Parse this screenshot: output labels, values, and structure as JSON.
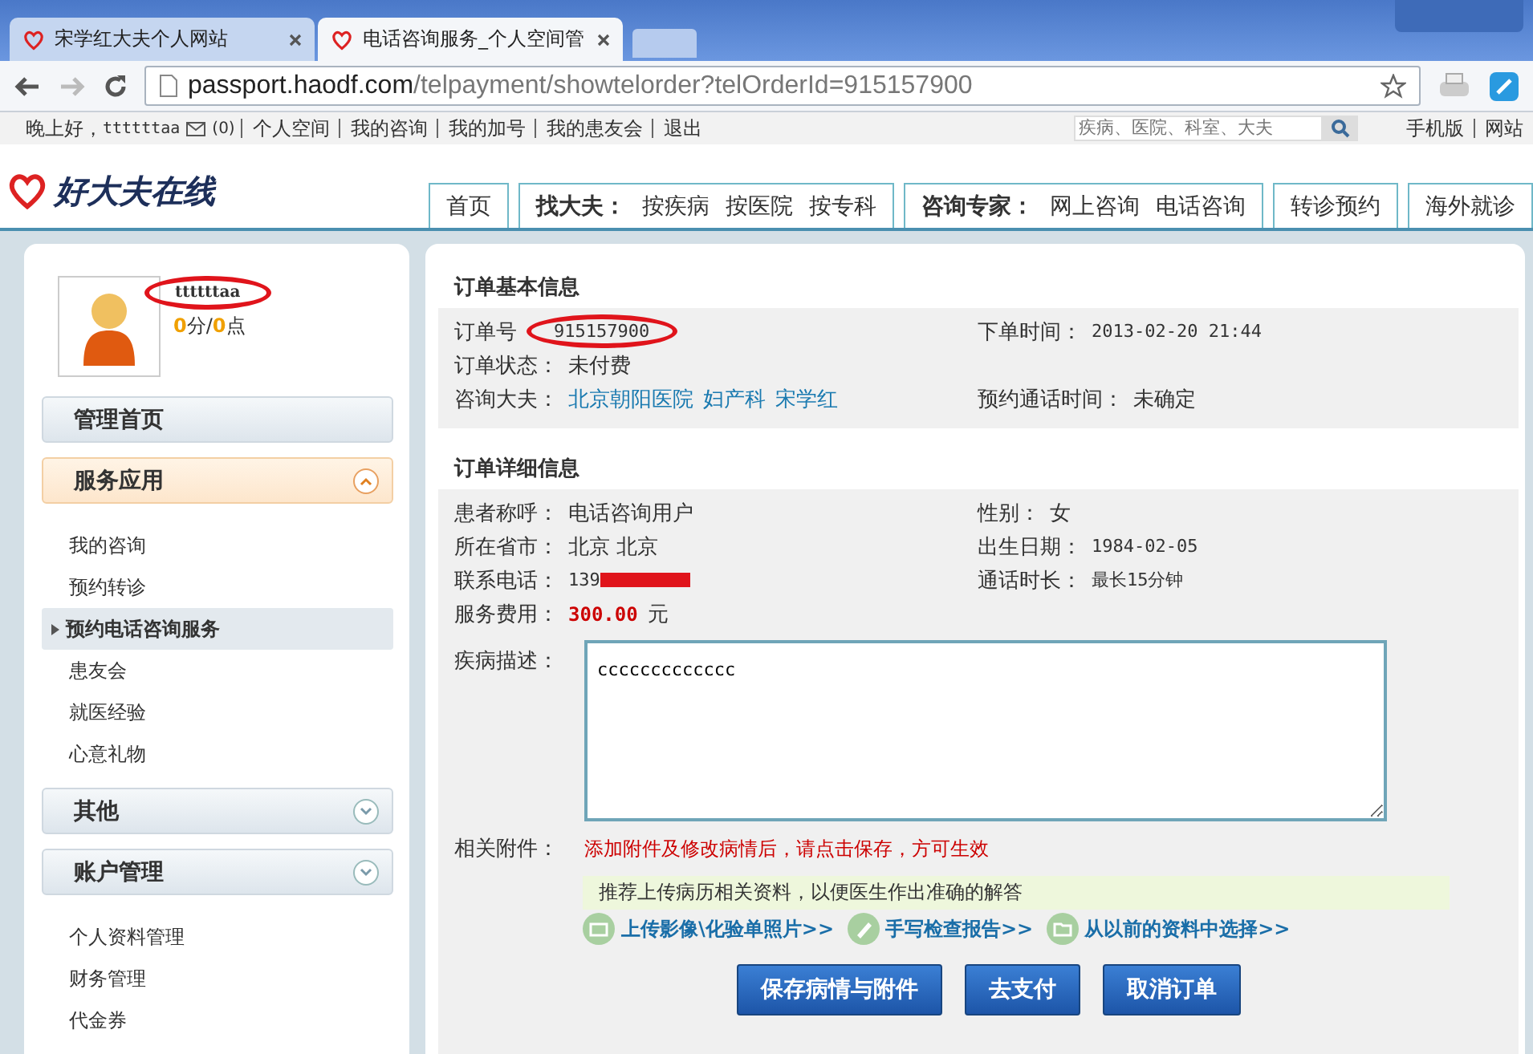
{
  "browser": {
    "tabs": [
      {
        "title": "宋学红大夫个人网站",
        "selected": false
      },
      {
        "title": "电话咨询服务_个人空间管",
        "selected": true
      }
    ],
    "url": {
      "host": "passport.haodf.com",
      "path": "/telpayment/showtelorder?telOrderId=915157900"
    }
  },
  "top_bar": {
    "greeting": "晚上好，",
    "username": "ttttttaa",
    "message_count": "(0)",
    "links": [
      "个人空间",
      "我的咨询",
      "我的加号",
      "我的患友会",
      "退出"
    ],
    "search": {
      "placeholder": "疾病、医院、科室、大夫"
    },
    "right_links": [
      "手机版",
      "网站"
    ]
  },
  "header": {
    "logo": "好大夫在线",
    "nav": [
      {
        "items": [
          "首页"
        ]
      },
      {
        "title": "找大夫：",
        "items": [
          "按疾病",
          "按医院",
          "按专科"
        ]
      },
      {
        "title": "咨询专家：",
        "items": [
          "网上咨询",
          "电话咨询"
        ]
      },
      {
        "items": [
          "转诊预约"
        ]
      },
      {
        "items": [
          "海外就诊"
        ]
      }
    ]
  },
  "sidebar": {
    "username": "ttttttaa",
    "score": "0",
    "score_unit": "分/",
    "points": "0",
    "points_unit": "点",
    "sections": [
      {
        "title": "管理首页",
        "kind": "plain",
        "expanded": false
      },
      {
        "title": "服务应用",
        "kind": "toggle",
        "expanded": true,
        "items": [
          {
            "label": "我的咨询",
            "selected": false
          },
          {
            "label": "预约转诊",
            "selected": false
          },
          {
            "label": "预约电话咨询服务",
            "selected": true
          },
          {
            "label": "患友会",
            "selected": false
          },
          {
            "label": "就医经验",
            "selected": false
          },
          {
            "label": "心意礼物",
            "selected": false
          }
        ]
      },
      {
        "title": "其他",
        "kind": "toggle",
        "expanded": false
      },
      {
        "title": "账户管理",
        "kind": "toggle",
        "expanded": false,
        "items": [
          {
            "label": "个人资料管理",
            "selected": false
          },
          {
            "label": "财务管理",
            "selected": false
          },
          {
            "label": "代金券",
            "selected": false
          }
        ]
      }
    ]
  },
  "basic_info": {
    "title": "订单基本信息",
    "rows": [
      {
        "label": "订单号",
        "value": "915157900",
        "kind": "circled",
        "right_label": "下单时间：",
        "right_value": "2013-02-20 21:44"
      },
      {
        "label": "订单状态：",
        "value": "未付费",
        "kind": "text"
      },
      {
        "label": "咨询大夫：",
        "links": [
          "北京朝阳医院",
          "妇产科",
          "宋学红"
        ],
        "kind": "links",
        "right_label": "预约通话时间：",
        "right_value": "未确定"
      }
    ]
  },
  "detail_info": {
    "title": "订单详细信息",
    "rows": [
      {
        "label": "患者称呼：",
        "value": "电话咨询用户",
        "kind": "text",
        "right_label": "性别：",
        "right_value": "女"
      },
      {
        "label": "所在省市：",
        "value": "北京 北京",
        "kind": "text",
        "right_label": "出生日期：",
        "right_value": "1984-02-05"
      },
      {
        "label": "联系电话：",
        "value": "139",
        "kind": "redacted",
        "right_label": "通话时长：",
        "right_value": "最长15分钟"
      },
      {
        "label": "服务费用：",
        "value": "300.00",
        "unit": "元",
        "kind": "price"
      }
    ],
    "description": {
      "label": "疾病描述：",
      "value": "ccccccccccccc"
    },
    "attachments": {
      "label": "相关附件：",
      "notice": "添加附件及修改病情后，请点击保存，方可生效",
      "tip": "推荐上传病历相关资料，以便医生作出准确的解答",
      "actions": [
        {
          "label": "上传影像\\化验单照片>>",
          "kind": "camera"
        },
        {
          "label": "手写检查报告>>",
          "kind": "pencil"
        },
        {
          "label": "从以前的资料中选择>>",
          "kind": "folder"
        }
      ]
    },
    "buttons": [
      "保存病情与附件",
      "去支付",
      "取消订单"
    ]
  }
}
